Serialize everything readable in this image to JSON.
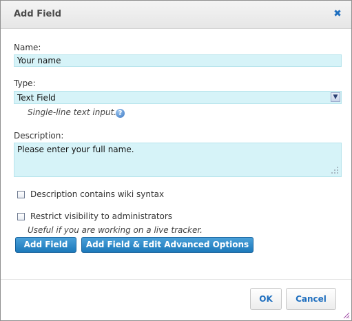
{
  "dialog": {
    "title": "Add Field",
    "close_icon": "close-icon"
  },
  "form": {
    "name_label": "Name:",
    "name_value": "Your name",
    "type_label": "Type:",
    "type_value": "Text Field",
    "type_hint": "Single-line text input.",
    "help_icon": "help-icon",
    "description_label": "Description:",
    "description_value": "Please enter your full name.",
    "wiki_syntax_label": "Description contains wiki syntax",
    "wiki_syntax_checked": false,
    "restrict_label": "Restrict visibility to administrators",
    "restrict_checked": false,
    "restrict_hint": "Useful if you are working on a live tracker."
  },
  "actions": {
    "add_field_label": "Add Field",
    "add_field_advanced_label": "Add Field & Edit Advanced Options"
  },
  "footer": {
    "ok_label": "OK",
    "cancel_label": "Cancel"
  },
  "colors": {
    "accent": "#1f6fbf",
    "field_bg": "#d6f3f8",
    "primary_button": "#2a86c8"
  }
}
